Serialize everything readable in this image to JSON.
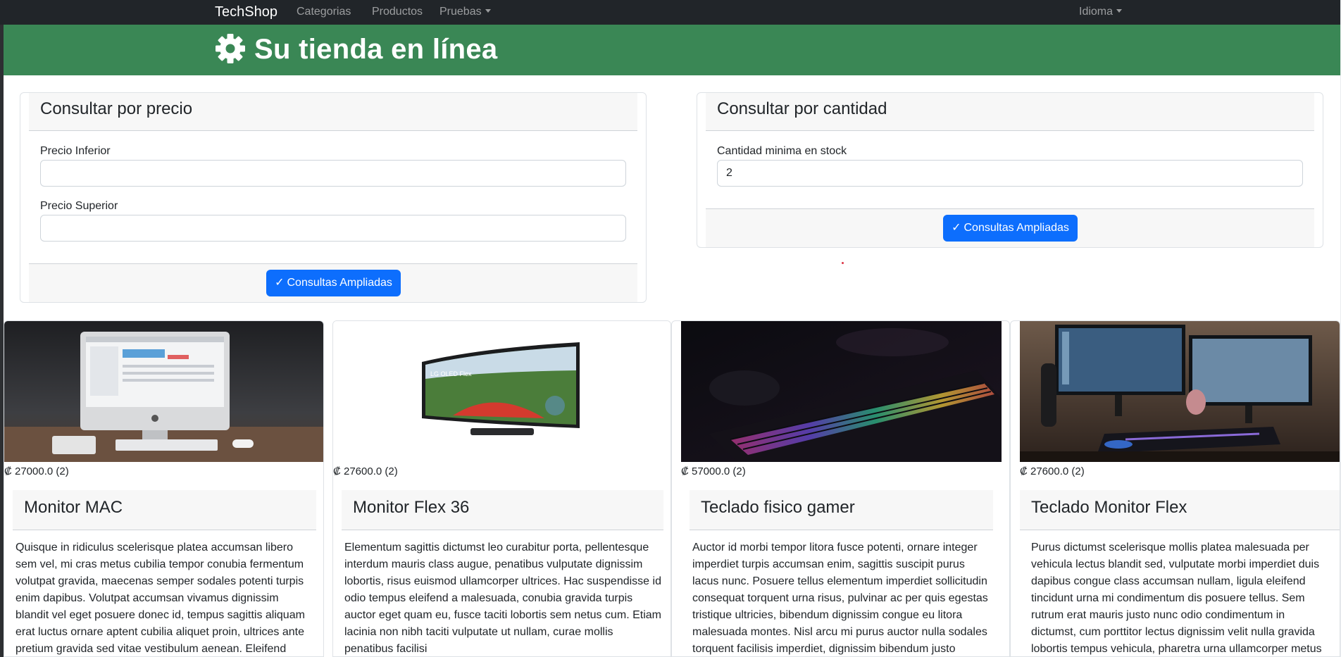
{
  "navbar": {
    "brand": "TechShop",
    "links": [
      "Categorias",
      "Productos",
      "Pruebas",
      "Idioma"
    ]
  },
  "hero": {
    "title": "Su tienda en línea",
    "icon": "gear-icon"
  },
  "precio_panel": {
    "title": "Consultar por precio",
    "inferior_label": "Precio Inferior",
    "inferior_value": "",
    "superior_label": "Precio Superior",
    "superior_value": "",
    "button": "Consultas Ampliadas"
  },
  "cantidad_panel": {
    "title": "Consultar por cantidad",
    "cantidad_label": "Cantidad minima en stock",
    "cantidad_value": "2",
    "button": "Consultas Ampliadas"
  },
  "products": [
    {
      "price": "₡ 27000.0 (2)",
      "title": "Monitor MAC",
      "description": "Quisque in ridiculus scelerisque platea accumsan libero sem vel, mi cras metus cubilia tempor conubia fermentum volutpat gravida, maecenas semper sodales potenti turpis enim dapibus. Volutpat accumsan vivamus dignissim blandit vel eget posuere donec id, tempus sagittis aliquam erat luctus ornare aptent cubilia aliquet proin, ultrices ante pretium gravida sed vitae vestibulum aenean. Eleifend"
    },
    {
      "price": "₡ 27600.0 (2)",
      "title": "Monitor Flex 36",
      "description": "Elementum sagittis dictumst leo curabitur porta, pellentesque interdum mauris class augue, penatibus vulputate dignissim lobortis, risus euismod ullamcorper ultrices. Hac suspendisse id odio tempus eleifend a malesuada, conubia gravida turpis auctor eget quam eu, fusce taciti lobortis sem netus cum. Etiam lacinia non nibh taciti vulputate ut nullam, curae mollis penatibus facilisi"
    },
    {
      "price": "₡ 57000.0 (2)",
      "title": "Teclado fisico gamer",
      "description": "Auctor id morbi tempor litora fusce potenti, ornare integer imperdiet turpis accumsan enim, sagittis suscipit purus lacus nunc. Posuere tellus elementum imperdiet sollicitudin consequat torquent urna risus, pulvinar ac per quis egestas tristique ultricies, bibendum dignissim congue eu litora malesuada montes. Nisl arcu mi purus auctor nulla sodales torquent facilisis imperdiet, dignissim bibendum justo"
    },
    {
      "price": "₡ 27600.0 (2)",
      "title": "Teclado Monitor Flex",
      "description": "Purus dictumst scelerisque mollis platea malesuada per vehicula lectus blandit sed, vulputate morbi imperdiet duis dapibus congue class accumsan nullam, ligula eleifend tincidunt urna mi condimentum dis posuere tellus. Sem rutrum erat mauris justo nunc odio condimentum in dictumst, cum porttitor lectus dignissim velit nulla gravida lobortis tempus vehicula, pharetra urna ullamcorper metus"
    }
  ]
}
